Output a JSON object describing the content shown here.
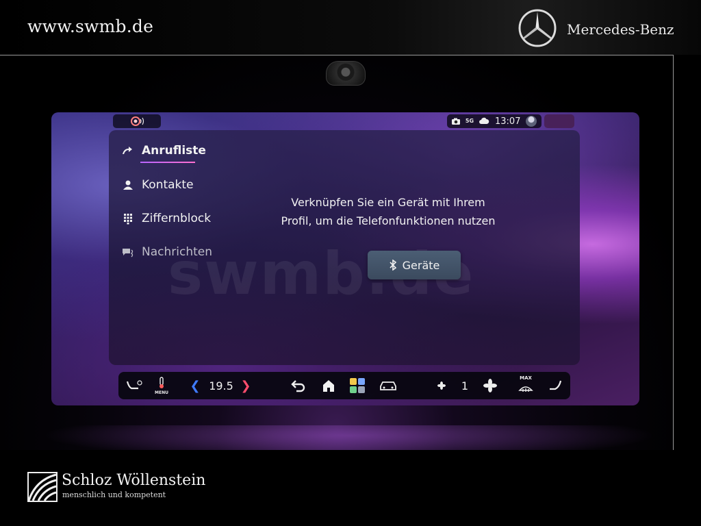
{
  "banner": {
    "url": "www.swmb.de",
    "brand_name": "Mercedes-Benz"
  },
  "status_bar": {
    "time": "13:07",
    "network": "5G"
  },
  "phone": {
    "nav": [
      {
        "label": "Anrufliste",
        "active": true,
        "icon": "call-list-icon"
      },
      {
        "label": "Kontakte",
        "active": false,
        "icon": "contact-icon"
      },
      {
        "label": "Ziffernblock",
        "active": false,
        "icon": "keypad-icon"
      },
      {
        "label": "Nachrichten",
        "active": false,
        "icon": "messages-icon"
      }
    ],
    "message_line1": "Verknüpfen Sie ein Gerät mit Ihrem",
    "message_line2": "Profil, um die Telefonfunktionen nutzen",
    "devices_button": "Geräte",
    "watermark": "swmb.de"
  },
  "climate": {
    "temperature": "19.5",
    "menu_label": "MENU",
    "fan_level": "1",
    "max_label": "MAX"
  },
  "footer": {
    "dealer_name": "Schloz Wöllenstein",
    "slogan": "menschlich und kompetent"
  },
  "colors": {
    "accent_underline": "#c06cff",
    "temp_down": "#3f7bff",
    "temp_up": "#ff4d6d",
    "button": "#45566b"
  }
}
